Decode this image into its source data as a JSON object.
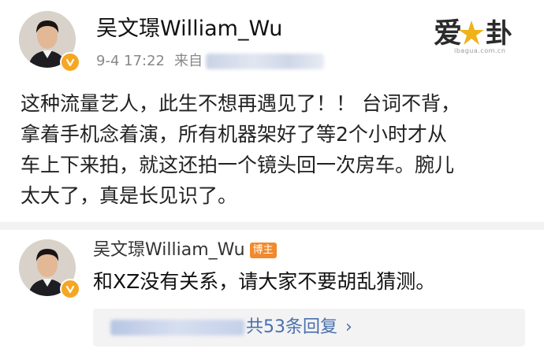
{
  "post": {
    "author": "吴文璟William_Wu",
    "time": "9-4 17:22",
    "source_prefix": "来自",
    "body_lines": [
      "这种流量艺人，此生不想再遇见了！！ 台词不背，",
      "拿着手机念着演，所有机器架好了等2个小时才从",
      "车上下来拍，就这还拍一个镜头回一次房车。腕儿",
      "太大了，真是长见识了。"
    ]
  },
  "watermark": {
    "brand": "爱八卦",
    "url_text": "ibagua.com.cn"
  },
  "comment": {
    "author": "吴文璟William_Wu",
    "badge": "博主",
    "text": "和XZ没有关系，请大家不要胡乱猜测。",
    "replies_text": "共53条回复",
    "chevron": "›"
  },
  "colors": {
    "verify_badge": "#f5a623",
    "host_badge": "#f08a2c",
    "link": "#4a6fae"
  },
  "icons": [
    "verified-v-icon",
    "chevron-right-icon"
  ]
}
